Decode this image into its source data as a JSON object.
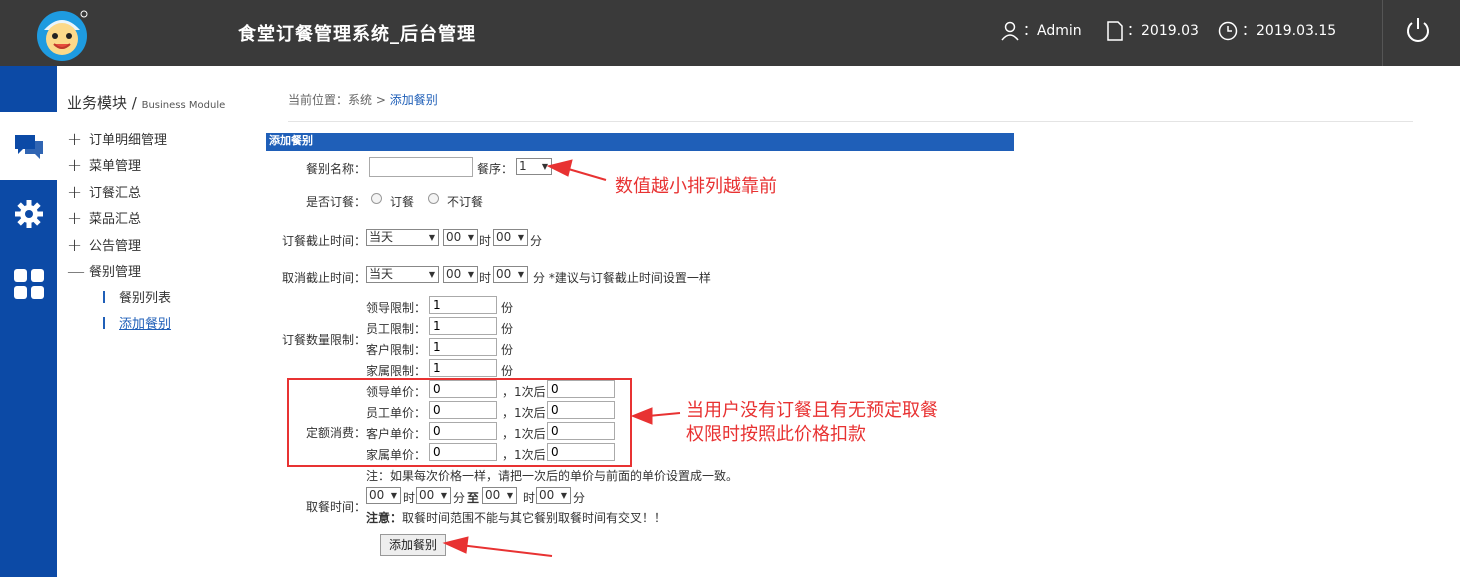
{
  "header": {
    "title": "食堂订餐管理系统_后台管理",
    "user": "：Admin",
    "version": "：2019.03",
    "date": "：2019.03.15"
  },
  "sidebar": {
    "title": "业务模块",
    "title_sep": " / ",
    "title_en": "Business Module",
    "items": [
      {
        "icon": "plus",
        "label": "订单明细管理"
      },
      {
        "icon": "plus",
        "label": "菜单管理"
      },
      {
        "icon": "plus",
        "label": "订餐汇总"
      },
      {
        "icon": "plus",
        "label": "菜品汇总"
      },
      {
        "icon": "plus",
        "label": "公告管理"
      },
      {
        "icon": "minus",
        "label": "餐别管理"
      }
    ],
    "subitems": [
      {
        "label": "餐别列表"
      },
      {
        "label": "添加餐别"
      }
    ]
  },
  "breadcrumb": {
    "prefix": "当前位置：系统 > ",
    "current": "添加餐别"
  },
  "form": {
    "section_title": "添加餐别",
    "meal_name_label": "餐别名称：",
    "meal_name_value": "",
    "order_label": "餐序：",
    "order_value": "1",
    "allow_order_label": "是否订餐：",
    "opt_yes": "订餐",
    "opt_no": "不订餐",
    "order_deadline_label": "订餐截止时间：",
    "cancel_deadline_label": "取消截止时间：",
    "deadline_day": "当天",
    "hour_value": "00",
    "minute_value": "00",
    "unit_hour": "时",
    "unit_minute": "分",
    "cancel_note": "分 *建议与订餐截止时间设置一样",
    "qty_limit_label": "订餐数量限制：",
    "limits": [
      {
        "label": "领导限制：",
        "value": "1",
        "unit": "份"
      },
      {
        "label": "员工限制：",
        "value": "1",
        "unit": "份"
      },
      {
        "label": "客户限制：",
        "value": "1",
        "unit": "份"
      },
      {
        "label": "家属限制：",
        "value": "1",
        "unit": "份"
      }
    ],
    "quota_label": "定额消费：",
    "prices": [
      {
        "label": "领导单价：",
        "value": "0",
        "after_label": "，1次后",
        "after_value": "0"
      },
      {
        "label": "员工单价：",
        "value": "0",
        "after_label": "，1次后",
        "after_value": "0"
      },
      {
        "label": "客户单价：",
        "value": "0",
        "after_label": "，1次后",
        "after_value": "0"
      },
      {
        "label": "家属单价：",
        "value": "0",
        "after_label": "，1次后",
        "after_value": "0"
      }
    ],
    "price_note": "注：如果每次价格一样，请把一次后的单价与前面的单价设置成一致。",
    "pickup_label": "取餐时间：",
    "to_label": "至",
    "pickup_note_bold": "注意：",
    "pickup_note": "取餐时间范围不能与其它餐别取餐时间有交叉！！",
    "submit_label": "添加餐别"
  },
  "annotations": {
    "note1": "数值越小排列越靠前",
    "note2_line1": "当用户没有订餐且有无预定取餐",
    "note2_line2": "权限时按照此价格扣款",
    "color": "#e83232"
  },
  "colors": {
    "header_bg": "#3a3a3a",
    "nav_bg": "#0c4aa6",
    "accent": "#1f5fb8"
  }
}
